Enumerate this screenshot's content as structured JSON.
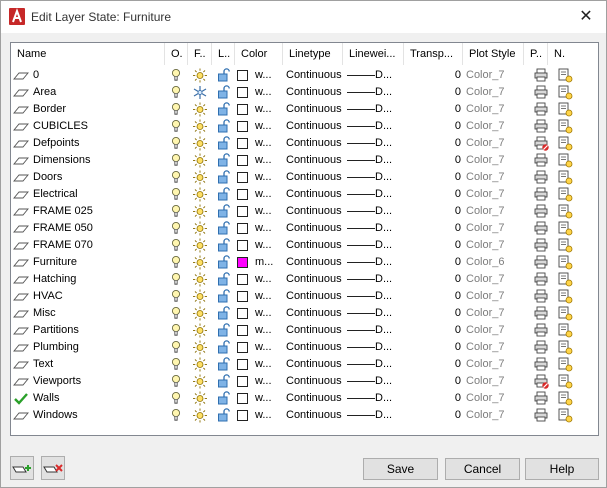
{
  "window": {
    "title": "Edit Layer State: Furniture",
    "close_symbol": "✕"
  },
  "columns": [
    "Name",
    "O.",
    "F..",
    "L..",
    "Color",
    "Linetype",
    "Linewei...",
    "Transp...",
    "Plot Style",
    "P..",
    "N."
  ],
  "layers": [
    {
      "name": "0",
      "color_name": "w...",
      "color_hex": "#ffffff",
      "linetype": "Continuous",
      "lineweight": "D...",
      "transparency": "0",
      "plot_style": "Color_7",
      "current": false,
      "frozen": false,
      "plot": true
    },
    {
      "name": "Area",
      "color_name": "w...",
      "color_hex": "#ffffff",
      "linetype": "Continuous",
      "lineweight": "D...",
      "transparency": "0",
      "plot_style": "Color_7",
      "current": false,
      "frozen": true,
      "plot": true
    },
    {
      "name": "Border",
      "color_name": "w...",
      "color_hex": "#ffffff",
      "linetype": "Continuous",
      "lineweight": "D...",
      "transparency": "0",
      "plot_style": "Color_7",
      "current": false,
      "frozen": false,
      "plot": true
    },
    {
      "name": "CUBICLES",
      "color_name": "w...",
      "color_hex": "#ffffff",
      "linetype": "Continuous",
      "lineweight": "D...",
      "transparency": "0",
      "plot_style": "Color_7",
      "current": false,
      "frozen": false,
      "plot": true
    },
    {
      "name": "Defpoints",
      "color_name": "w...",
      "color_hex": "#ffffff",
      "linetype": "Continuous",
      "lineweight": "D...",
      "transparency": "0",
      "plot_style": "Color_7",
      "current": false,
      "frozen": false,
      "plot": false
    },
    {
      "name": "Dimensions",
      "color_name": "w...",
      "color_hex": "#ffffff",
      "linetype": "Continuous",
      "lineweight": "D...",
      "transparency": "0",
      "plot_style": "Color_7",
      "current": false,
      "frozen": false,
      "plot": true
    },
    {
      "name": "Doors",
      "color_name": "w...",
      "color_hex": "#ffffff",
      "linetype": "Continuous",
      "lineweight": "D...",
      "transparency": "0",
      "plot_style": "Color_7",
      "current": false,
      "frozen": false,
      "plot": true
    },
    {
      "name": "Electrical",
      "color_name": "w...",
      "color_hex": "#ffffff",
      "linetype": "Continuous",
      "lineweight": "D...",
      "transparency": "0",
      "plot_style": "Color_7",
      "current": false,
      "frozen": false,
      "plot": true
    },
    {
      "name": "FRAME 025",
      "color_name": "w...",
      "color_hex": "#ffffff",
      "linetype": "Continuous",
      "lineweight": "D...",
      "transparency": "0",
      "plot_style": "Color_7",
      "current": false,
      "frozen": false,
      "plot": true
    },
    {
      "name": "FRAME 050",
      "color_name": "w...",
      "color_hex": "#ffffff",
      "linetype": "Continuous",
      "lineweight": "D...",
      "transparency": "0",
      "plot_style": "Color_7",
      "current": false,
      "frozen": false,
      "plot": true
    },
    {
      "name": "FRAME 070",
      "color_name": "w...",
      "color_hex": "#ffffff",
      "linetype": "Continuous",
      "lineweight": "D...",
      "transparency": "0",
      "plot_style": "Color_7",
      "current": false,
      "frozen": false,
      "plot": true
    },
    {
      "name": "Furniture",
      "color_name": "m...",
      "color_hex": "#ff00ff",
      "linetype": "Continuous",
      "lineweight": "D...",
      "transparency": "0",
      "plot_style": "Color_6",
      "current": false,
      "frozen": false,
      "plot": true
    },
    {
      "name": "Hatching",
      "color_name": "w...",
      "color_hex": "#ffffff",
      "linetype": "Continuous",
      "lineweight": "D...",
      "transparency": "0",
      "plot_style": "Color_7",
      "current": false,
      "frozen": false,
      "plot": true
    },
    {
      "name": "HVAC",
      "color_name": "w...",
      "color_hex": "#ffffff",
      "linetype": "Continuous",
      "lineweight": "D...",
      "transparency": "0",
      "plot_style": "Color_7",
      "current": false,
      "frozen": false,
      "plot": true
    },
    {
      "name": "Misc",
      "color_name": "w...",
      "color_hex": "#ffffff",
      "linetype": "Continuous",
      "lineweight": "D...",
      "transparency": "0",
      "plot_style": "Color_7",
      "current": false,
      "frozen": false,
      "plot": true
    },
    {
      "name": "Partitions",
      "color_name": "w...",
      "color_hex": "#ffffff",
      "linetype": "Continuous",
      "lineweight": "D...",
      "transparency": "0",
      "plot_style": "Color_7",
      "current": false,
      "frozen": false,
      "plot": true
    },
    {
      "name": "Plumbing",
      "color_name": "w...",
      "color_hex": "#ffffff",
      "linetype": "Continuous",
      "lineweight": "D...",
      "transparency": "0",
      "plot_style": "Color_7",
      "current": false,
      "frozen": false,
      "plot": true
    },
    {
      "name": "Text",
      "color_name": "w...",
      "color_hex": "#ffffff",
      "linetype": "Continuous",
      "lineweight": "D...",
      "transparency": "0",
      "plot_style": "Color_7",
      "current": false,
      "frozen": false,
      "plot": true
    },
    {
      "name": "Viewports",
      "color_name": "w...",
      "color_hex": "#ffffff",
      "linetype": "Continuous",
      "lineweight": "D...",
      "transparency": "0",
      "plot_style": "Color_7",
      "current": false,
      "frozen": false,
      "plot": false
    },
    {
      "name": "Walls",
      "color_name": "w...",
      "color_hex": "#ffffff",
      "linetype": "Continuous",
      "lineweight": "D...",
      "transparency": "0",
      "plot_style": "Color_7",
      "current": true,
      "frozen": false,
      "plot": true
    },
    {
      "name": "Windows",
      "color_name": "w...",
      "color_hex": "#ffffff",
      "linetype": "Continuous",
      "lineweight": "D...",
      "transparency": "0",
      "plot_style": "Color_7",
      "current": false,
      "frozen": false,
      "plot": true
    }
  ],
  "buttons": {
    "save": "Save",
    "cancel": "Cancel",
    "help": "Help"
  },
  "toolbar_icons": [
    "add-layers-icon",
    "remove-layers-icon"
  ],
  "colors": {
    "accent_red": "#d92b2b",
    "current_check": "#2aa02a",
    "plot_style_gray": "#7d7d7d",
    "magenta": "#ff00ff"
  }
}
